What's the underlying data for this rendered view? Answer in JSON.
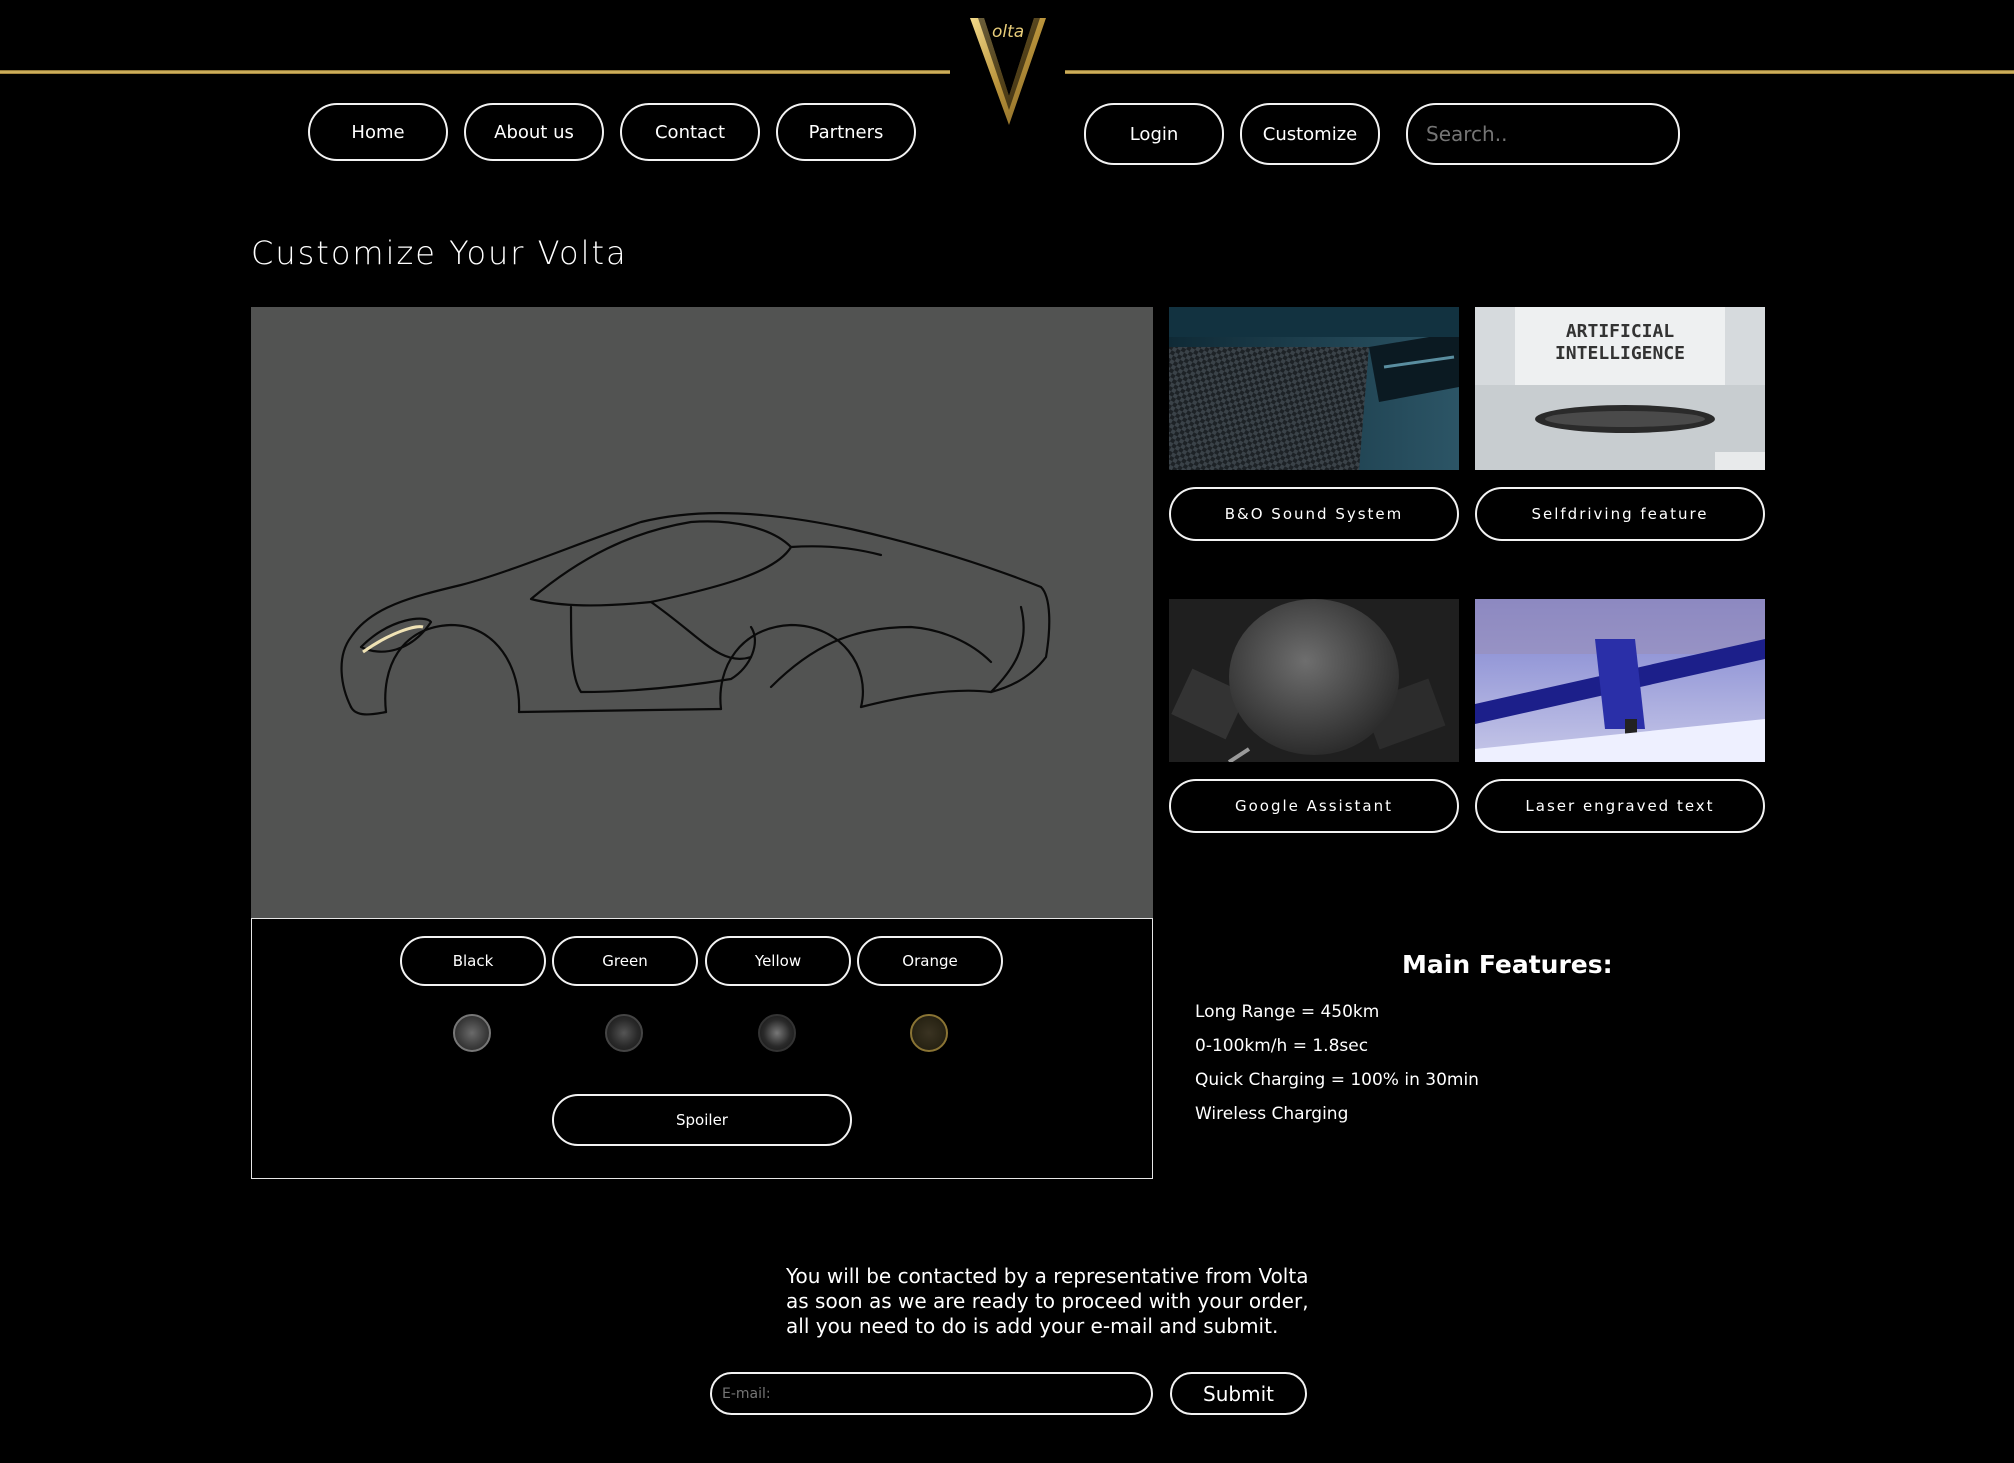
{
  "logo": {
    "text": "olta"
  },
  "nav": {
    "home": "Home",
    "about": "About us",
    "contact": "Contact",
    "partners": "Partners",
    "login": "Login",
    "customize": "Customize",
    "search_placeholder": "Search.."
  },
  "page_title": "Customize Your Volta",
  "features": [
    {
      "label": "B&O Sound System",
      "image": "carbon-door-panel"
    },
    {
      "label": "Selfdriving feature",
      "image": "ai-typewriter",
      "image_text": [
        "ARTIFICIAL",
        "INTELLIGENCE"
      ]
    },
    {
      "label": "Google Assistant",
      "image": "smart-speaker"
    },
    {
      "label": "Laser engraved text",
      "image": "laser-engraver"
    }
  ],
  "colors": [
    "Black",
    "Green",
    "Yellow",
    "Orange"
  ],
  "rims": [
    {
      "name": "rim-style-1",
      "color": "#4a4a4a"
    },
    {
      "name": "rim-style-2",
      "color": "#3b3b3b"
    },
    {
      "name": "rim-style-3",
      "color": "#2d2d2d"
    },
    {
      "name": "rim-style-4",
      "color": "#6b5a2a"
    }
  ],
  "spoiler_label": "Spoiler",
  "main_features": {
    "title": "Main Features:",
    "items": [
      "Long Range = 450km",
      "0-100km/h = 1.8sec",
      "Quick Charging = 100% in 30min",
      "Wireless Charging"
    ]
  },
  "contact_text": [
    "You will be contacted by a representative from Volta",
    "as soon as we are ready to proceed with your order,",
    "all you need to do is add your e-mail and submit."
  ],
  "email_placeholder": "E-mail:",
  "submit_label": "Submit",
  "colors_theme": {
    "gold": "#d4b45a",
    "preview_bg": "#525352"
  }
}
